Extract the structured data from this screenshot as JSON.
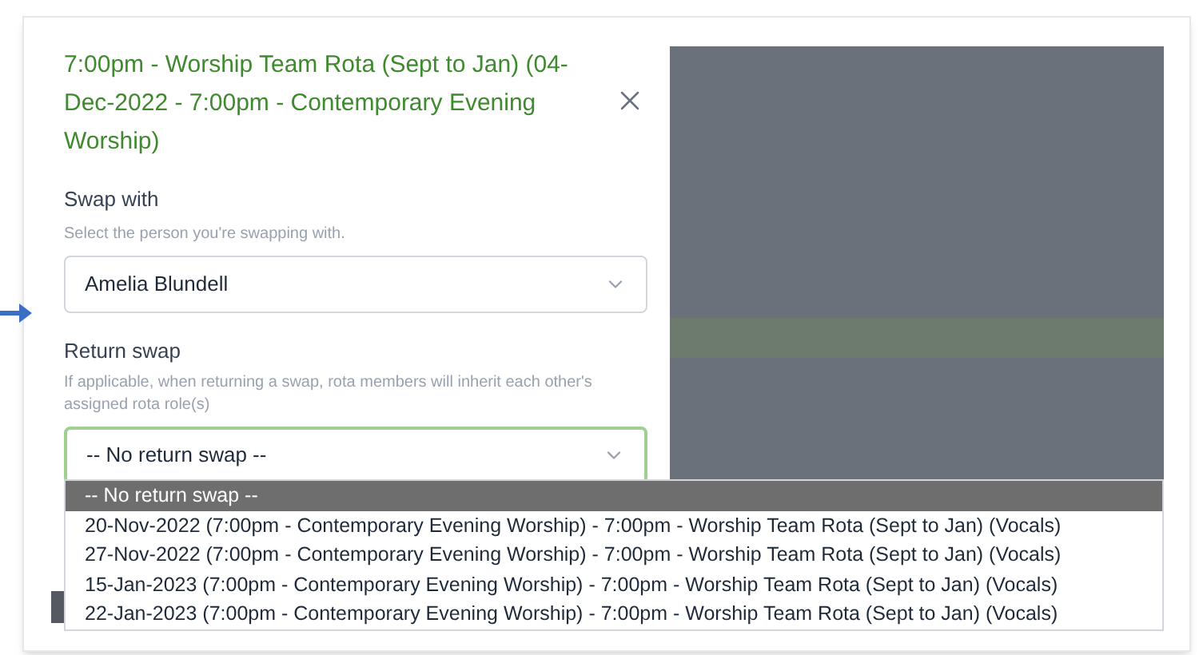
{
  "dialog": {
    "title": "7:00pm - Worship Team Rota (Sept to Jan) (04-Dec-2022 - 7:00pm - Contemporary Evening Worship)"
  },
  "swap_with": {
    "label": "Swap with",
    "hint": "Select the person you're swapping with.",
    "value": "Amelia Blundell"
  },
  "return_swap": {
    "label": "Return swap",
    "hint": "If applicable, when returning a swap, rota members will inherit each other's assigned rota role(s)",
    "value": "-- No return swap --",
    "expanded": true,
    "options": [
      {
        "label": "-- No return swap --",
        "selected": true
      },
      {
        "label": "20-Nov-2022 (7:00pm - Contemporary Evening Worship) - 7:00pm - Worship Team Rota (Sept to Jan) (Vocals)",
        "selected": false
      },
      {
        "label": "27-Nov-2022 (7:00pm - Contemporary Evening Worship) - 7:00pm - Worship Team Rota (Sept to Jan) (Vocals)",
        "selected": false
      },
      {
        "label": "15-Jan-2023 (7:00pm - Contemporary Evening Worship) - 7:00pm - Worship Team Rota (Sept to Jan) (Vocals)",
        "selected": false
      },
      {
        "label": "22-Jan-2023 (7:00pm - Contemporary Evening Worship) - 7:00pm - Worship Team Rota (Sept to Jan) (Vocals)",
        "selected": false
      }
    ]
  }
}
